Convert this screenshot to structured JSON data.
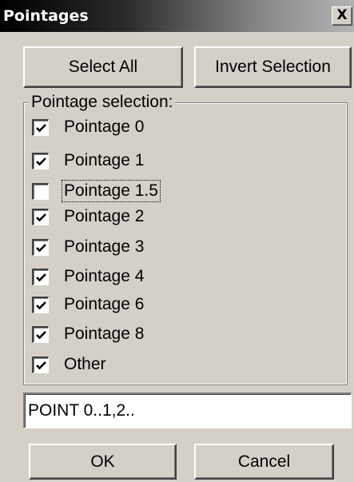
{
  "window": {
    "title": "Pointages",
    "close_glyph": "X"
  },
  "toolbar": {
    "select_all_label": "Select All",
    "invert_selection_label": "Invert Selection"
  },
  "group": {
    "legend": "Pointage selection:",
    "items": [
      {
        "label": "Pointage 0",
        "checked": true
      },
      {
        "label": "Pointage 1",
        "checked": true
      },
      {
        "label": "Pointage 1.5",
        "checked": false,
        "focused": true
      },
      {
        "label": "Pointage 2",
        "checked": true
      },
      {
        "label": "Pointage 3",
        "checked": true
      },
      {
        "label": "Pointage 4",
        "checked": true
      },
      {
        "label": "Pointage 6",
        "checked": true
      },
      {
        "label": "Pointage 8",
        "checked": true
      },
      {
        "label": "Other",
        "checked": true
      }
    ]
  },
  "filter": {
    "value": "POINT 0..1,2.."
  },
  "footer": {
    "ok_label": "OK",
    "cancel_label": "Cancel"
  },
  "colors": {
    "face": "#d4d0c8",
    "title_gradient_start": "#000000",
    "title_gradient_end": "#b4b4b4"
  }
}
